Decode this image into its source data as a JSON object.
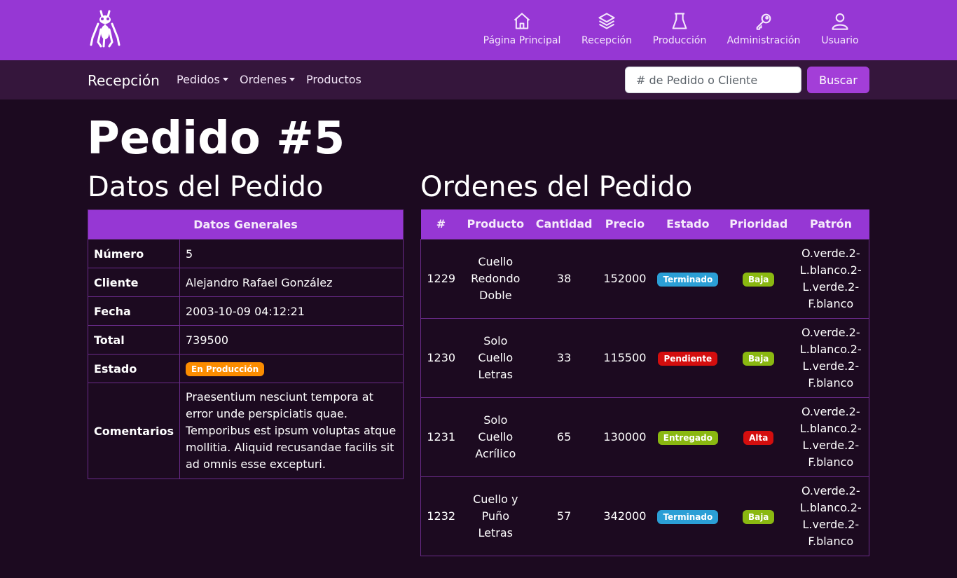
{
  "topnav": {
    "items": [
      {
        "label": "Página Principal",
        "icon": "house-icon"
      },
      {
        "label": "Recepción",
        "icon": "layers-icon"
      },
      {
        "label": "Producción",
        "icon": "lab-flask-icon"
      },
      {
        "label": "Administración",
        "icon": "key-icon"
      },
      {
        "label": "Usuario",
        "icon": "person-icon"
      }
    ]
  },
  "subnav": {
    "brand": "Recepción",
    "pedidos": "Pedidos",
    "ordenes": "Ordenes",
    "productos": "Productos",
    "search_placeholder": "# de Pedido o Cliente",
    "search_button": "Buscar"
  },
  "page_title": "Pedido #5",
  "datos": {
    "section_title": "Datos del Pedido",
    "table_header": "Datos Generales",
    "numero_label": "Número",
    "numero": "5",
    "cliente_label": "Cliente",
    "cliente": "Alejandro Rafael González",
    "fecha_label": "Fecha",
    "fecha": "2003-10-09 04:12:21",
    "total_label": "Total",
    "total": "739500",
    "estado_label": "Estado",
    "estado": "En Producción",
    "comentarios_label": "Comentarios",
    "comentarios": "Praesentium nesciunt tempora at error unde perspiciatis quae. Temporibus est ipsum voluptas atque mollitia. Aliquid recusandae facilis sit ad omnis esse excepturi."
  },
  "ordenes": {
    "section_title": "Ordenes del Pedido",
    "headers": [
      "#",
      "Producto",
      "Cantidad",
      "Precio",
      "Estado",
      "Prioridad",
      "Patrón"
    ],
    "rows": [
      {
        "id": "1229",
        "producto": [
          "Cuello",
          "Redondo",
          "Doble"
        ],
        "cantidad": "38",
        "precio": "152000",
        "estado": "Terminado",
        "prioridad": "Baja",
        "patron": [
          "O.verde.2-",
          "L.blanco.2-",
          "L.verde.2-",
          "F.blanco"
        ]
      },
      {
        "id": "1230",
        "producto": [
          "Solo",
          "Cuello",
          "Letras"
        ],
        "cantidad": "33",
        "precio": "115500",
        "estado": "Pendiente",
        "prioridad": "Baja",
        "patron": [
          "O.verde.2-",
          "L.blanco.2-",
          "L.verde.2-",
          "F.blanco"
        ]
      },
      {
        "id": "1231",
        "producto": [
          "Solo",
          "Cuello",
          "Acrílico"
        ],
        "cantidad": "65",
        "precio": "130000",
        "estado": "Entregado",
        "prioridad": "Alta",
        "patron": [
          "O.verde.2-",
          "L.blanco.2-",
          "L.verde.2-",
          "F.blanco"
        ]
      },
      {
        "id": "1232",
        "producto": [
          "Cuello y",
          "Puño",
          "Letras"
        ],
        "cantidad": "57",
        "precio": "342000",
        "estado": "Terminado",
        "prioridad": "Baja",
        "patron": [
          "O.verde.2-",
          "L.blanco.2-",
          "L.verde.2-",
          "F.blanco"
        ]
      }
    ]
  },
  "colors": {
    "topbar": "#9637d4",
    "subbar": "#35163c",
    "background": "#1c0a20",
    "badge_terminado": "#2b9fd6",
    "badge_pendiente": "#d40e0e",
    "badge_entregado": "#8ab811",
    "badge_baja": "#8ab811",
    "badge_alta": "#d40e0e",
    "badge_en_produccion": "#fb8c00"
  }
}
